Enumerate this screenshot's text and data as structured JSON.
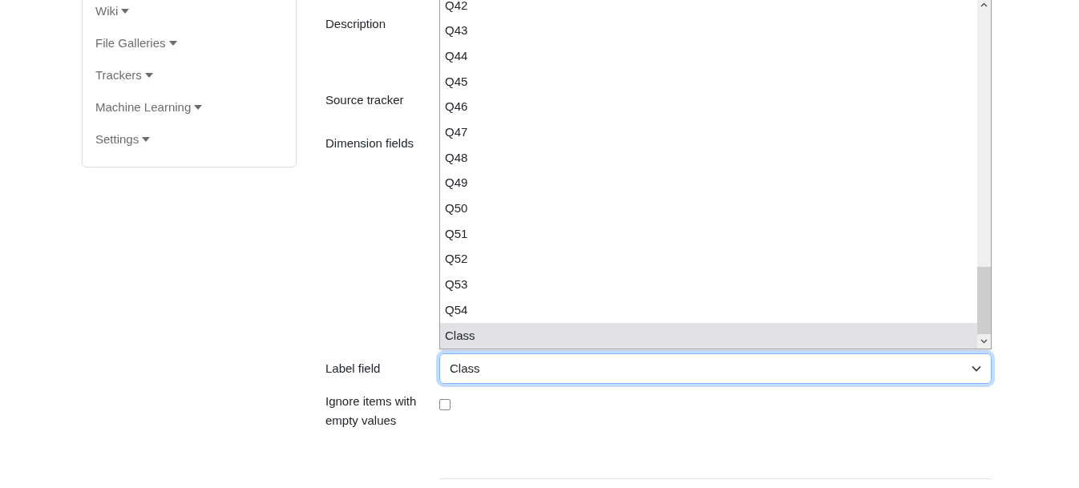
{
  "sidebar": {
    "items": [
      {
        "label": "Wiki"
      },
      {
        "label": "File Galleries"
      },
      {
        "label": "Trackers"
      },
      {
        "label": "Machine Learning"
      },
      {
        "label": "Settings"
      }
    ]
  },
  "form": {
    "fields": [
      {
        "kind": "covered",
        "label": "Description"
      },
      {
        "kind": "covered",
        "label": "Source tracker"
      },
      {
        "kind": "covered",
        "label": "Dimension fields"
      },
      {
        "kind": "select",
        "label": "Label field",
        "value": "Class"
      },
      {
        "kind": "checkbox",
        "label": "Ignore items with empty values",
        "checked": false
      }
    ]
  },
  "dropdown": {
    "options": [
      {
        "label": "Q42",
        "selected": false
      },
      {
        "label": "Q43",
        "selected": false
      },
      {
        "label": "Q44",
        "selected": false
      },
      {
        "label": "Q45",
        "selected": false
      },
      {
        "label": "Q46",
        "selected": false
      },
      {
        "label": "Q47",
        "selected": false
      },
      {
        "label": "Q48",
        "selected": false
      },
      {
        "label": "Q49",
        "selected": false
      },
      {
        "label": "Q50",
        "selected": false
      },
      {
        "label": "Q51",
        "selected": false
      },
      {
        "label": "Q52",
        "selected": false
      },
      {
        "label": "Q53",
        "selected": false
      },
      {
        "label": "Q54",
        "selected": false
      },
      {
        "label": "Class",
        "selected": true
      }
    ]
  }
}
